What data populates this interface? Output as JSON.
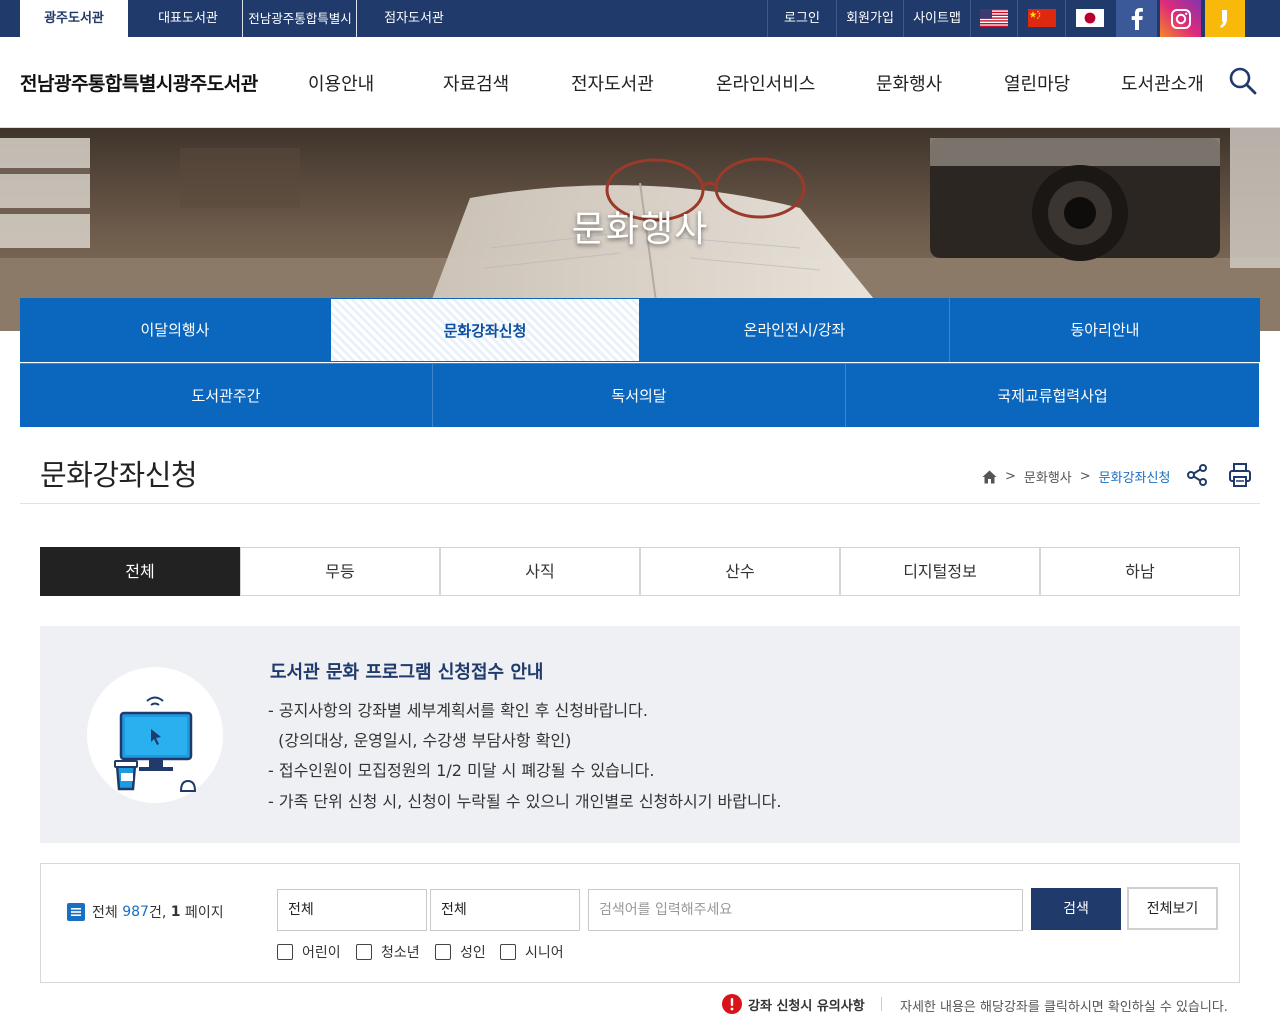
{
  "topbar": {
    "libraries": [
      "광주도서관",
      "대표도서관",
      "전남광주통합특별시",
      "점자도서관"
    ],
    "util_links": [
      "로그인",
      "회원가입",
      "사이트맵"
    ],
    "languages": [
      "english",
      "chinese",
      "japanese"
    ],
    "sns": [
      "facebook",
      "instagram",
      "kakao-story"
    ]
  },
  "header": {
    "logo": "전남광주통합특별시광주도서관",
    "gnb": [
      "이용안내",
      "자료검색",
      "전자도서관",
      "온라인서비스",
      "문화행사",
      "열린마당",
      "도서관소개"
    ]
  },
  "banner": {
    "title": "문화행사"
  },
  "submenu": {
    "row1": [
      "이달의행사",
      "문화강좌신청",
      "온라인전시/강좌",
      "동아리안내"
    ],
    "row2": [
      "도서관주간",
      "독서의달",
      "국제교류협력사업"
    ],
    "active": "문화강좌신청"
  },
  "page": {
    "title": "문화강좌신청",
    "breadcrumb": [
      "문화행사",
      "문화강좌신청"
    ]
  },
  "category_tabs": [
    "전체",
    "무등",
    "사직",
    "산수",
    "디지털정보",
    "하남"
  ],
  "notice": {
    "title": "도서관 문화 프로그램 신청접수 안내",
    "lines": [
      "- 공지사항의 강좌별 세부계획서를 확인 후 신청바랍니다.",
      "  (강의대상, 운영일시, 수강생 부담사항 확인)",
      "- 접수인원이 모집정원의 1/2 미달 시 폐강될 수 있습니다.",
      "- 가족 단위 신청 시, 신청이 누락될 수 있으니 개인별로 신청하시기 바랍니다."
    ]
  },
  "search": {
    "count_prefix": "전체 ",
    "count": "987",
    "count_mid": "건, ",
    "page": "1",
    "page_suffix": " 페이지",
    "select1": "전체",
    "select2": "전체",
    "placeholder": "검색어를 입력해주세요",
    "search_label": "검색",
    "view_all_label": "전체보기",
    "checkboxes": [
      "어린이",
      "청소년",
      "성인",
      "시니어"
    ]
  },
  "caution": {
    "label": "강좌 신청시 유의사항",
    "desc": "자세한 내용은 해당강좌를 클릭하시면 확인하실 수 있습니다."
  },
  "colors": {
    "navy": "#1f3a6b",
    "blue": "#0a67bd",
    "accent": "#1a6fc2"
  }
}
